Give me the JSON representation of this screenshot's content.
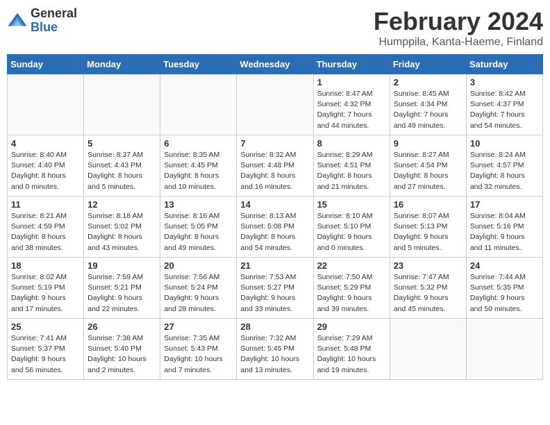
{
  "header": {
    "logo_general": "General",
    "logo_blue": "Blue",
    "title": "February 2024",
    "location": "Humppila, Kanta-Haeme, Finland"
  },
  "days_of_week": [
    "Sunday",
    "Monday",
    "Tuesday",
    "Wednesday",
    "Thursday",
    "Friday",
    "Saturday"
  ],
  "weeks": [
    [
      {
        "day": "",
        "info": ""
      },
      {
        "day": "",
        "info": ""
      },
      {
        "day": "",
        "info": ""
      },
      {
        "day": "",
        "info": ""
      },
      {
        "day": "1",
        "info": "Sunrise: 8:47 AM\nSunset: 4:32 PM\nDaylight: 7 hours\nand 44 minutes."
      },
      {
        "day": "2",
        "info": "Sunrise: 8:45 AM\nSunset: 4:34 PM\nDaylight: 7 hours\nand 49 minutes."
      },
      {
        "day": "3",
        "info": "Sunrise: 8:42 AM\nSunset: 4:37 PM\nDaylight: 7 hours\nand 54 minutes."
      }
    ],
    [
      {
        "day": "4",
        "info": "Sunrise: 8:40 AM\nSunset: 4:40 PM\nDaylight: 8 hours\nand 0 minutes."
      },
      {
        "day": "5",
        "info": "Sunrise: 8:37 AM\nSunset: 4:43 PM\nDaylight: 8 hours\nand 5 minutes."
      },
      {
        "day": "6",
        "info": "Sunrise: 8:35 AM\nSunset: 4:45 PM\nDaylight: 8 hours\nand 10 minutes."
      },
      {
        "day": "7",
        "info": "Sunrise: 8:32 AM\nSunset: 4:48 PM\nDaylight: 8 hours\nand 16 minutes."
      },
      {
        "day": "8",
        "info": "Sunrise: 8:29 AM\nSunset: 4:51 PM\nDaylight: 8 hours\nand 21 minutes."
      },
      {
        "day": "9",
        "info": "Sunrise: 8:27 AM\nSunset: 4:54 PM\nDaylight: 8 hours\nand 27 minutes."
      },
      {
        "day": "10",
        "info": "Sunrise: 8:24 AM\nSunset: 4:57 PM\nDaylight: 8 hours\nand 32 minutes."
      }
    ],
    [
      {
        "day": "11",
        "info": "Sunrise: 8:21 AM\nSunset: 4:59 PM\nDaylight: 8 hours\nand 38 minutes."
      },
      {
        "day": "12",
        "info": "Sunrise: 8:18 AM\nSunset: 5:02 PM\nDaylight: 8 hours\nand 43 minutes."
      },
      {
        "day": "13",
        "info": "Sunrise: 8:16 AM\nSunset: 5:05 PM\nDaylight: 8 hours\nand 49 minutes."
      },
      {
        "day": "14",
        "info": "Sunrise: 8:13 AM\nSunset: 5:08 PM\nDaylight: 8 hours\nand 54 minutes."
      },
      {
        "day": "15",
        "info": "Sunrise: 8:10 AM\nSunset: 5:10 PM\nDaylight: 9 hours\nand 0 minutes."
      },
      {
        "day": "16",
        "info": "Sunrise: 8:07 AM\nSunset: 5:13 PM\nDaylight: 9 hours\nand 5 minutes."
      },
      {
        "day": "17",
        "info": "Sunrise: 8:04 AM\nSunset: 5:16 PM\nDaylight: 9 hours\nand 11 minutes."
      }
    ],
    [
      {
        "day": "18",
        "info": "Sunrise: 8:02 AM\nSunset: 5:19 PM\nDaylight: 9 hours\nand 17 minutes."
      },
      {
        "day": "19",
        "info": "Sunrise: 7:59 AM\nSunset: 5:21 PM\nDaylight: 9 hours\nand 22 minutes."
      },
      {
        "day": "20",
        "info": "Sunrise: 7:56 AM\nSunset: 5:24 PM\nDaylight: 9 hours\nand 28 minutes."
      },
      {
        "day": "21",
        "info": "Sunrise: 7:53 AM\nSunset: 5:27 PM\nDaylight: 9 hours\nand 33 minutes."
      },
      {
        "day": "22",
        "info": "Sunrise: 7:50 AM\nSunset: 5:29 PM\nDaylight: 9 hours\nand 39 minutes."
      },
      {
        "day": "23",
        "info": "Sunrise: 7:47 AM\nSunset: 5:32 PM\nDaylight: 9 hours\nand 45 minutes."
      },
      {
        "day": "24",
        "info": "Sunrise: 7:44 AM\nSunset: 5:35 PM\nDaylight: 9 hours\nand 50 minutes."
      }
    ],
    [
      {
        "day": "25",
        "info": "Sunrise: 7:41 AM\nSunset: 5:37 PM\nDaylight: 9 hours\nand 56 minutes."
      },
      {
        "day": "26",
        "info": "Sunrise: 7:38 AM\nSunset: 5:40 PM\nDaylight: 10 hours\nand 2 minutes."
      },
      {
        "day": "27",
        "info": "Sunrise: 7:35 AM\nSunset: 5:43 PM\nDaylight: 10 hours\nand 7 minutes."
      },
      {
        "day": "28",
        "info": "Sunrise: 7:32 AM\nSunset: 5:45 PM\nDaylight: 10 hours\nand 13 minutes."
      },
      {
        "day": "29",
        "info": "Sunrise: 7:29 AM\nSunset: 5:48 PM\nDaylight: 10 hours\nand 19 minutes."
      },
      {
        "day": "",
        "info": ""
      },
      {
        "day": "",
        "info": ""
      }
    ]
  ]
}
